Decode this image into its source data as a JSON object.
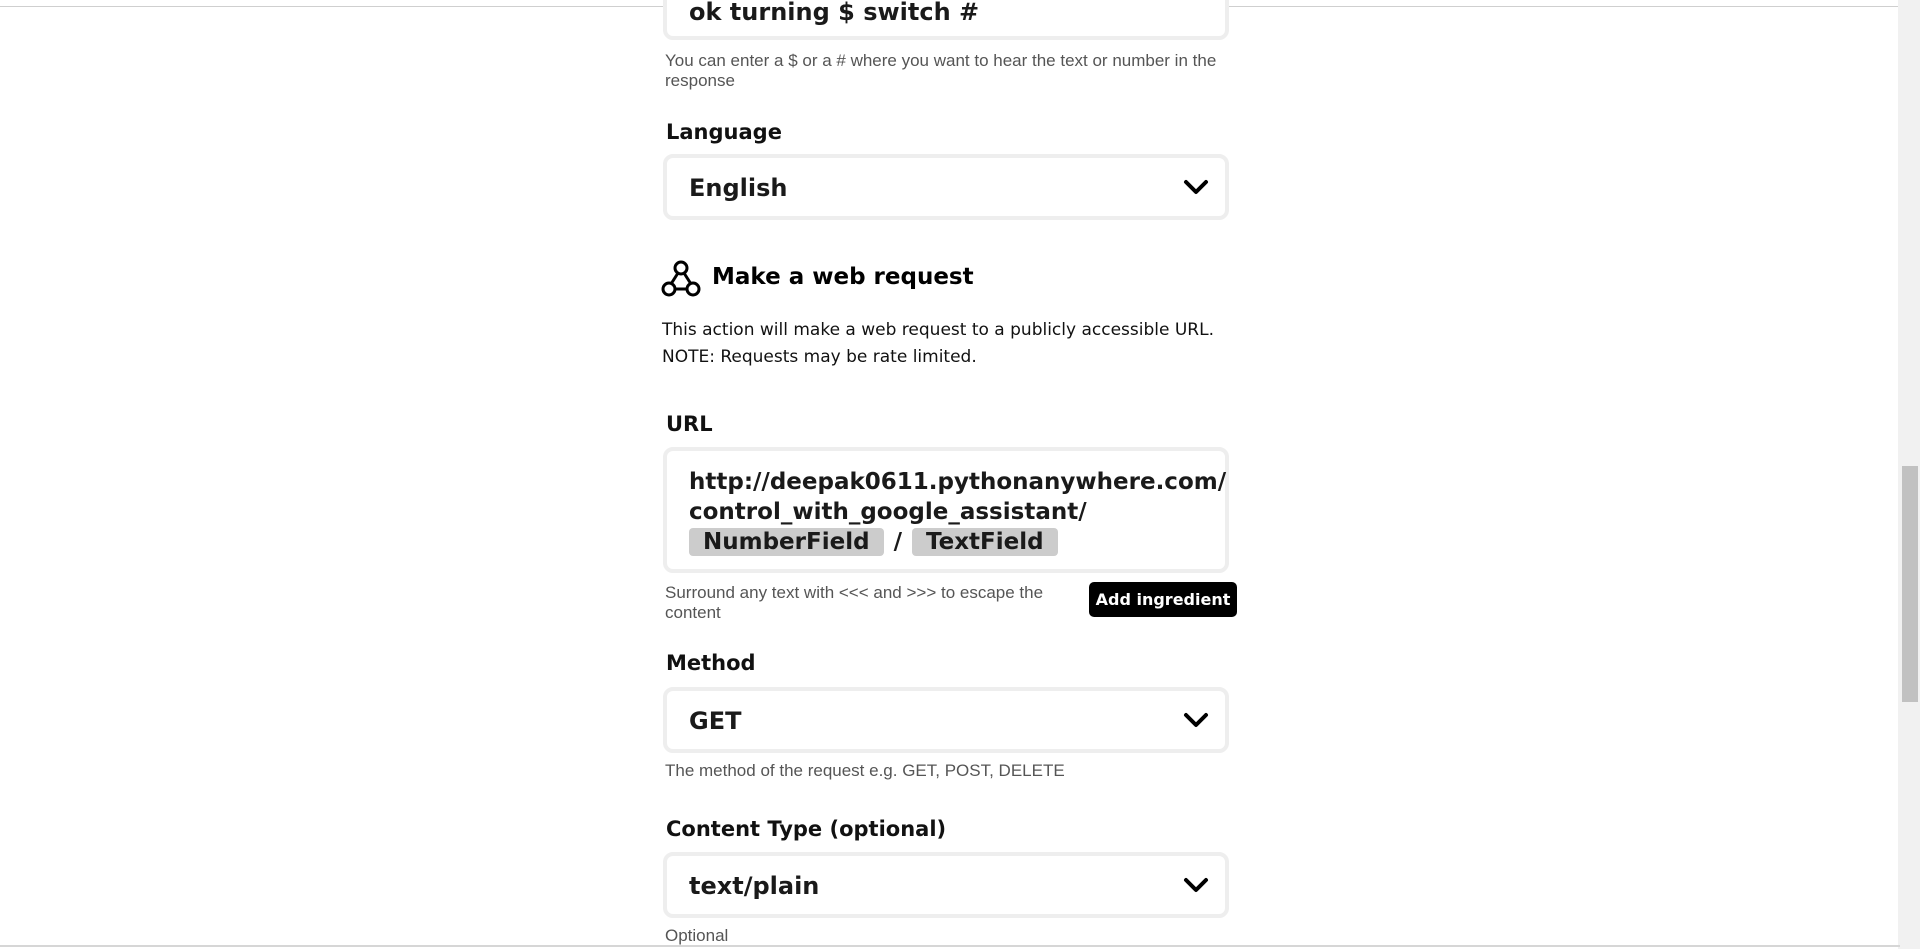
{
  "response": {
    "value": "ok turning $ switch #",
    "helper": "You can enter a $ or a # where you want to hear the text or number in the response"
  },
  "language": {
    "label": "Language",
    "selected": "English"
  },
  "action": {
    "icon": "webhooks-icon",
    "title": "Make a web request",
    "description": "This action will make a web request to a publicly accessible URL. NOTE: Requests may be rate limited."
  },
  "url": {
    "label": "URL",
    "line1": "http://deepak0611.pythonanywhere.com/",
    "line2": "control_with_google_assistant/",
    "ingredient1": "NumberField",
    "separator": "/",
    "ingredient2": "TextField",
    "helper": "Surround any text with <<< and >>> to escape the content",
    "add_ingredient": "Add ingredient"
  },
  "method": {
    "label": "Method",
    "selected": "GET",
    "helper": "The method of the request e.g. GET, POST, DELETE"
  },
  "content_type": {
    "label": "Content Type (optional)",
    "selected": "text/plain",
    "helper": "Optional"
  }
}
